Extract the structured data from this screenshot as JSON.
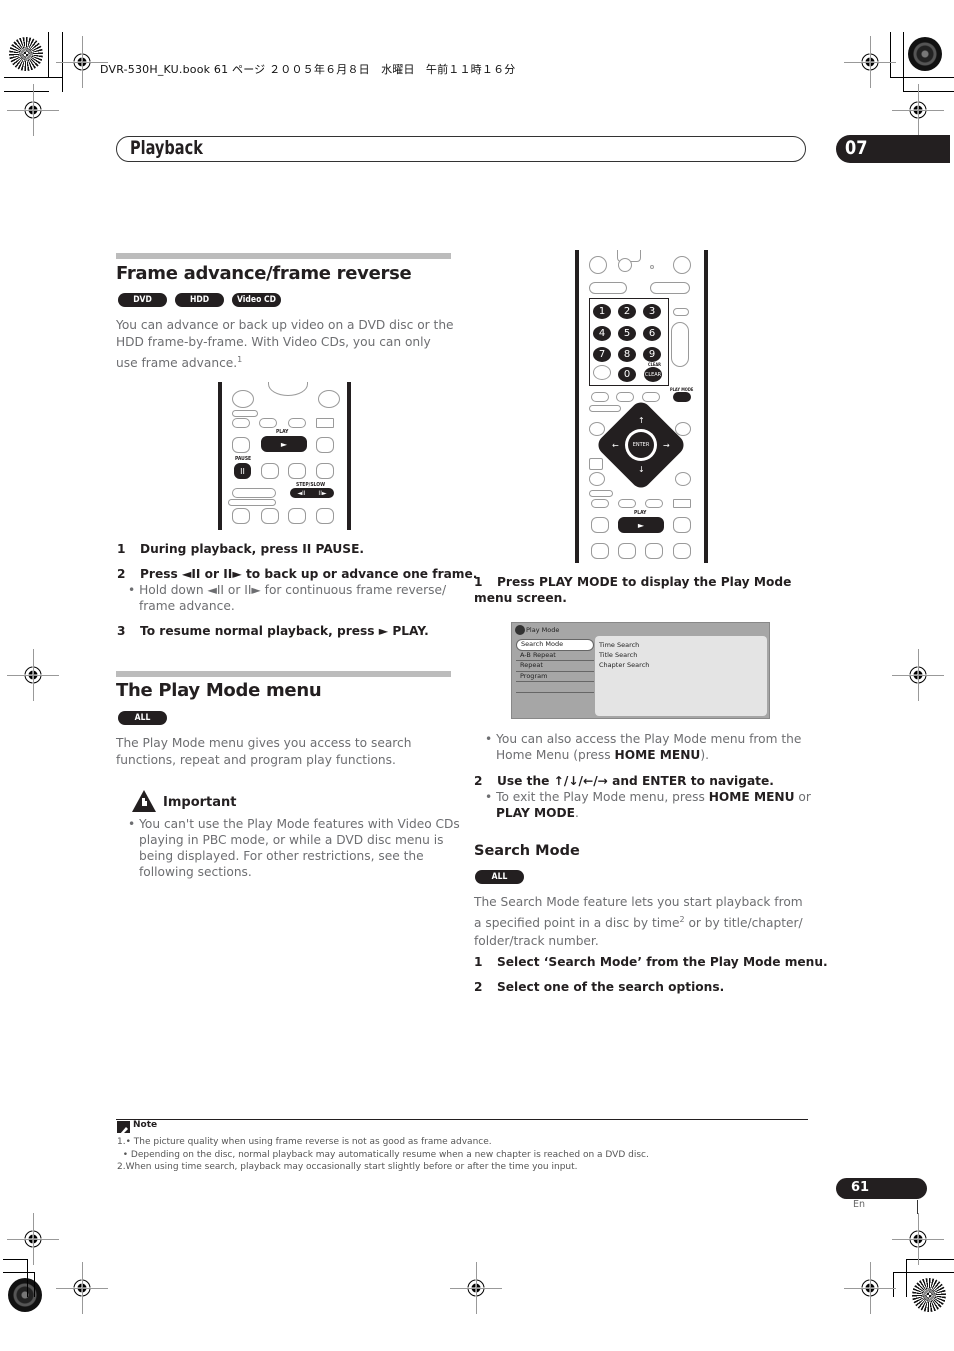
{
  "print_header": "DVR-530H_KU.book  61 ページ  ２００５年６月８日　水曜日　午前１１時１６分",
  "chapter": {
    "title": "Playback",
    "number": "07"
  },
  "frame_section": {
    "heading": "Frame advance/frame reverse",
    "badges": [
      "DVD",
      "HDD",
      "Video CD"
    ],
    "intro": "You can advance or back up video on a DVD disc or the HDD frame-by-frame. With Video CDs, you can only use frame advance.",
    "intro_footnote": "1",
    "remote_labels": {
      "play": "PLAY",
      "pause": "PAUSE",
      "step_slow": "STEP/SLOW",
      "play_glyph": "►",
      "pause_glyph": "II",
      "step_back_glyph": "◄II",
      "step_fwd_glyph": "II►"
    },
    "steps": [
      {
        "num": "1",
        "text": "During playback, press II PAUSE."
      },
      {
        "num": "2",
        "text": "Press ◄II or II► to back up or advance one frame."
      },
      {
        "num": "3",
        "text": "To resume normal playback, press ► PLAY."
      }
    ],
    "step2_bullet": "Hold down ◄II or II► for continuous frame reverse/ frame advance."
  },
  "play_mode_section": {
    "heading": "The Play Mode menu",
    "badges": [
      "ALL"
    ],
    "intro": "The Play Mode menu gives you access to search functions, repeat and program play functions.",
    "important_title": "Important",
    "important_bullet": "You can't use the Play Mode features with Video CDs playing in PBC mode, or while a DVD disc menu is being displayed. For other restrictions, see the following sections."
  },
  "remote2": {
    "digits": [
      "1",
      "2",
      "3",
      "4",
      "5",
      "6",
      "7",
      "8",
      "9",
      "0"
    ],
    "clear_label": "CLEAR",
    "play_mode_label": "PLAY MODE",
    "enter_label": "ENTER",
    "play_label": "PLAY",
    "play_glyph": "►"
  },
  "right_steps": {
    "step1_num": "1",
    "step1": "Press PLAY MODE to display the Play Mode menu screen.",
    "bullet1_pre": "You can also access the Play Mode menu from the Home Menu (press ",
    "bullet1_bold": "HOME MENU",
    "bullet1_post": ").",
    "step2_num": "2",
    "step2": "Use the ↑/↓/←/→ and ENTER to navigate.",
    "bullet2_pre": "To exit the Play Mode menu, press ",
    "bullet2_bold1": "HOME MENU",
    "bullet2_mid": " or ",
    "bullet2_bold2": "PLAY MODE",
    "bullet2_post": "."
  },
  "osd": {
    "title": "Play Mode",
    "menu_items": [
      "Search Mode",
      "A-B Repeat",
      "Repeat",
      "Program",
      ""
    ],
    "selected_index": 0,
    "options": [
      "Time Search",
      "Title Search",
      "Chapter Search"
    ]
  },
  "search_mode": {
    "heading": "Search Mode",
    "badges": [
      "ALL"
    ],
    "intro_pre": "The Search Mode feature lets you start playback from a specified point in a disc by time",
    "intro_footnote": "2",
    "intro_post": " or by title/chapter/ folder/track number.",
    "steps": [
      {
        "num": "1",
        "text": "Select ‘Search Mode’ from the Play Mode menu."
      },
      {
        "num": "2",
        "text": "Select one of the search options."
      }
    ]
  },
  "notes": {
    "title": "Note",
    "lines": [
      "1.• The picture quality when using frame reverse is not as good as frame advance.",
      "  • Depending on the disc, normal playback may automatically resume when a new chapter is reached on a DVD disc.",
      "2.When using time search, playback may occasionally start slightly before or after the time you input."
    ]
  },
  "footer": {
    "page_number": "61",
    "language": "En"
  }
}
